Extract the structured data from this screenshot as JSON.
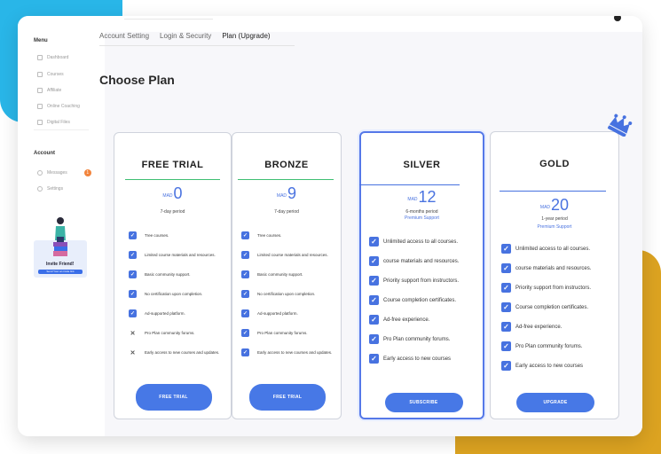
{
  "colors": {
    "accent": "#4772e0",
    "blue_blob": "#29b6e8",
    "gold_blob": "#dca321",
    "green_line": "#3fbf73",
    "badge": "#f2843c"
  },
  "sidebar": {
    "menu_title": "Menu",
    "items": [
      {
        "label": "Dashboard",
        "icon": "home-icon"
      },
      {
        "label": "Courses",
        "icon": "book-icon"
      },
      {
        "label": "Affiliate",
        "icon": "share-icon"
      },
      {
        "label": "Online Coaching",
        "icon": "video-icon"
      },
      {
        "label": "Digital Files",
        "icon": "file-icon"
      }
    ],
    "account_title": "Account",
    "account_items": [
      {
        "label": "Messages",
        "icon": "chat-icon",
        "badge": "1"
      },
      {
        "label": "Settings",
        "icon": "gear-icon"
      }
    ],
    "invite": {
      "title": "Invite Friend!",
      "button": "Send Your an invite link",
      "icon": "person-with-books-icon"
    }
  },
  "tabs": [
    "Account Setting",
    "Login & Security",
    "Plan (Upgrade)"
  ],
  "active_tab": "Plan (Upgrade)",
  "page_title": "Choose Plan",
  "plans": [
    {
      "name": "FREE TRIAL",
      "currency": "MAD",
      "price": "0",
      "period": "7-day period",
      "support": "",
      "button": "FREE TRIAL",
      "features": [
        {
          "text": "Tree courses.",
          "included": true
        },
        {
          "text": "Limited course materials and resources.",
          "included": true
        },
        {
          "text": "Basic community support.",
          "included": true
        },
        {
          "text": "No certification upon completion.",
          "included": true
        },
        {
          "text": "Ad-supported platform.",
          "included": true
        },
        {
          "text": "Pro Plan community forums.",
          "included": false
        },
        {
          "text": "Early access to new courses and updates.",
          "included": false
        }
      ]
    },
    {
      "name": "BRONZE",
      "currency": "MAD",
      "price": "9",
      "period": "7-day period",
      "support": "",
      "button": "FREE TRIAL",
      "features": [
        {
          "text": "Tree courses.",
          "included": true
        },
        {
          "text": "Limited course materials and resources.",
          "included": true
        },
        {
          "text": "Basic community support.",
          "included": true
        },
        {
          "text": "No certification upon completion.",
          "included": true
        },
        {
          "text": "Ad-supported platform.",
          "included": true
        },
        {
          "text": "Pro Plan community forums.",
          "included": true
        },
        {
          "text": "Early access to new courses and updates.",
          "included": true
        }
      ]
    },
    {
      "name": "SILVER",
      "currency": "MAD",
      "price": "12",
      "period": "6-months period",
      "support": "Premium Support",
      "button": "SUBSCRIBE",
      "features": [
        {
          "text": "Unlimited access to all courses.",
          "included": true
        },
        {
          "text": "course materials and resources.",
          "included": true
        },
        {
          "text": "Priority support from instructors.",
          "included": true
        },
        {
          "text": "Course completion certificates.",
          "included": true
        },
        {
          "text": "Ad-free experience.",
          "included": true
        },
        {
          "text": "Pro Plan community forums.",
          "included": true
        },
        {
          "text": "Early access to new courses",
          "included": true
        }
      ]
    },
    {
      "name": "GOLD",
      "currency": "MAD",
      "price": "20",
      "period": "1-year period",
      "support": "Premium Support",
      "button": "UPGRADE",
      "features": [
        {
          "text": "Unlimited access to all courses.",
          "included": true
        },
        {
          "text": "course materials and resources.",
          "included": true
        },
        {
          "text": "Priority support from instructors.",
          "included": true
        },
        {
          "text": "Course completion certificates.",
          "included": true
        },
        {
          "text": "Ad-free experience.",
          "included": true
        },
        {
          "text": "Pro Plan community forums.",
          "included": true
        },
        {
          "text": "Early access to new courses",
          "included": true
        }
      ]
    }
  ]
}
